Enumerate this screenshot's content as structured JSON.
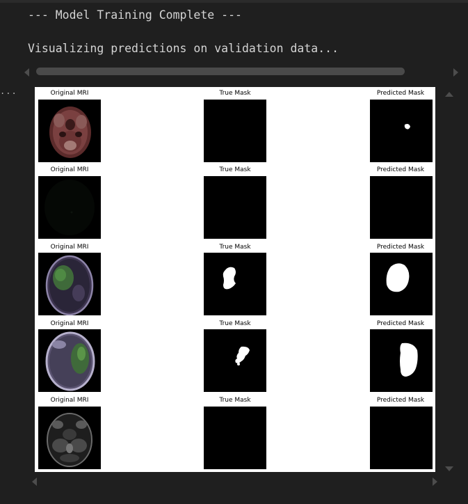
{
  "output": {
    "lines": [
      "--- Model Training Complete ---",
      "Visualizing predictions on validation data..."
    ]
  },
  "ellipsis": "...",
  "figure": {
    "column_titles": [
      "Original MRI",
      "True Mask",
      "Predicted Mask"
    ],
    "rows": [
      {
        "mri": "MRI slice 1",
        "true_mask": "empty",
        "predicted_mask": "small spot"
      },
      {
        "mri": "MRI slice 2 (dark)",
        "true_mask": "empty",
        "predicted_mask": "empty"
      },
      {
        "mri": "MRI slice 3",
        "true_mask": "lesion",
        "predicted_mask": "lesion"
      },
      {
        "mri": "MRI slice 4",
        "true_mask": "lesion",
        "predicted_mask": "lesion"
      },
      {
        "mri": "MRI slice 5",
        "true_mask": "empty",
        "predicted_mask": "empty"
      }
    ]
  },
  "colors": {
    "background": "#1f1f1f",
    "text": "#d4d4d4",
    "scrollbar": "#4a4a4a"
  }
}
